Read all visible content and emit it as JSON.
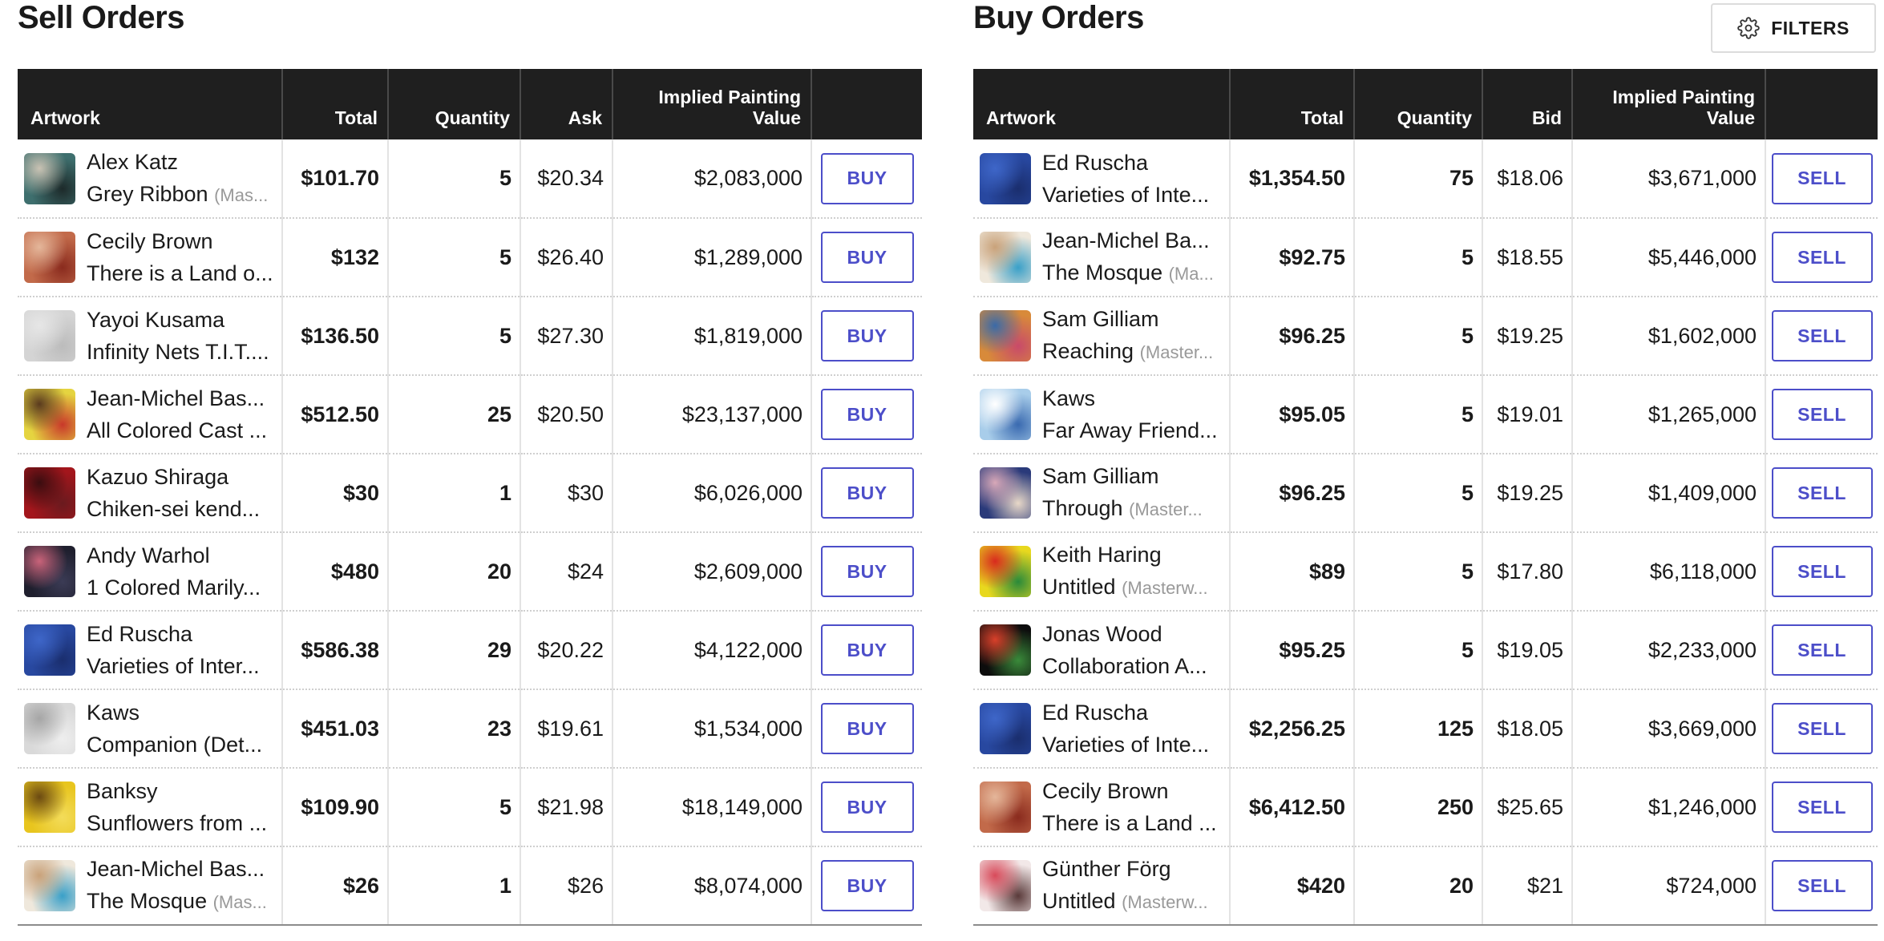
{
  "filters_label": "FILTERS",
  "accent_color": "#4c4ec9",
  "sell": {
    "title": "Sell Orders",
    "columns": {
      "artwork": "Artwork",
      "total": "Total",
      "quantity": "Quantity",
      "price": "Ask",
      "implied": "Implied Painting Value"
    },
    "action_label": "BUY",
    "rows": [
      {
        "artist": "Alex Katz",
        "title": "Grey Ribbon",
        "edition": "(Mas...",
        "total": "$101.70",
        "quantity": "5",
        "price": "$20.34",
        "implied": "$2,083,000",
        "thumb_colors": [
          "#3e6f6e",
          "#c9c2b3",
          "#1d2a2a"
        ]
      },
      {
        "artist": "Cecily Brown",
        "title": "There is a Land o...",
        "edition": "",
        "total": "$132",
        "quantity": "5",
        "price": "$26.40",
        "implied": "$1,289,000",
        "thumb_colors": [
          "#c26a4a",
          "#e4b69a",
          "#8a2b1e"
        ]
      },
      {
        "artist": "Yayoi Kusama",
        "title": "Infinity Nets T.I.T....",
        "edition": "",
        "total": "$136.50",
        "quantity": "5",
        "price": "$27.30",
        "implied": "$1,819,000",
        "thumb_colors": [
          "#d4d4d4",
          "#e6e6e6",
          "#bcbcbc"
        ]
      },
      {
        "artist": "Jean-Michel Bas...",
        "title": "All Colored Cast ...",
        "edition": "",
        "total": "$512.50",
        "quantity": "25",
        "price": "$20.50",
        "implied": "$23,137,000",
        "thumb_colors": [
          "#e5d440",
          "#5a3a1e",
          "#c8382a"
        ]
      },
      {
        "artist": "Kazuo Shiraga",
        "title": "Chiken-sei kend...",
        "edition": "",
        "total": "$30",
        "quantity": "1",
        "price": "$30",
        "implied": "$6,026,000",
        "thumb_colors": [
          "#a3161c",
          "#3a0d10",
          "#6a1a1e"
        ]
      },
      {
        "artist": "Andy Warhol",
        "title": "1 Colored Marily...",
        "edition": "",
        "total": "$480",
        "quantity": "20",
        "price": "$24",
        "implied": "$2,609,000",
        "thumb_colors": [
          "#1f1f2e",
          "#c9637a",
          "#3b3b55"
        ]
      },
      {
        "artist": "Ed Ruscha",
        "title": "Varieties of Inter...",
        "edition": "",
        "total": "$586.38",
        "quantity": "29",
        "price": "$20.22",
        "implied": "$4,122,000",
        "thumb_colors": [
          "#2848a0",
          "#3e66c8",
          "#1a2e6e"
        ]
      },
      {
        "artist": "Kaws",
        "title": "Companion (Det...",
        "edition": "",
        "total": "$451.03",
        "quantity": "23",
        "price": "$19.61",
        "implied": "$1,534,000",
        "thumb_colors": [
          "#d9d9d9",
          "#a6a6a6",
          "#eeeeee"
        ]
      },
      {
        "artist": "Banksy",
        "title": "Sunflowers from ...",
        "edition": "",
        "total": "$109.90",
        "quantity": "5",
        "price": "$21.98",
        "implied": "$18,149,000",
        "thumb_colors": [
          "#e8c51e",
          "#6b4a12",
          "#f3dc5a"
        ]
      },
      {
        "artist": "Jean-Michel Bas...",
        "title": "The Mosque",
        "edition": "(Mas...",
        "total": "$26",
        "quantity": "1",
        "price": "$26",
        "implied": "$8,074,000",
        "thumb_colors": [
          "#efe8dc",
          "#c9a27a",
          "#3aa0c8"
        ]
      }
    ]
  },
  "buy": {
    "title": "Buy Orders",
    "columns": {
      "artwork": "Artwork",
      "total": "Total",
      "quantity": "Quantity",
      "price": "Bid",
      "implied": "Implied Painting Value"
    },
    "action_label": "SELL",
    "rows": [
      {
        "artist": "Ed Ruscha",
        "title": "Varieties of Inte...",
        "edition": "",
        "total": "$1,354.50",
        "quantity": "75",
        "price": "$18.06",
        "implied": "$3,671,000",
        "thumb_colors": [
          "#2848a0",
          "#3e66c8",
          "#1a2e6e"
        ]
      },
      {
        "artist": "Jean-Michel Ba...",
        "title": "The Mosque",
        "edition": "(Ma...",
        "total": "$92.75",
        "quantity": "5",
        "price": "$18.55",
        "implied": "$5,446,000",
        "thumb_colors": [
          "#efe8dc",
          "#c9a27a",
          "#3aa0c8"
        ]
      },
      {
        "artist": "Sam Gilliam",
        "title": "Reaching",
        "edition": "(Master...",
        "total": "$96.25",
        "quantity": "5",
        "price": "$19.25",
        "implied": "$1,602,000",
        "thumb_colors": [
          "#d88a3a",
          "#3a6aa8",
          "#c84a6a"
        ]
      },
      {
        "artist": "Kaws",
        "title": "Far Away Friend...",
        "edition": "",
        "total": "$95.05",
        "quantity": "5",
        "price": "$19.01",
        "implied": "$1,265,000",
        "thumb_colors": [
          "#a8cdea",
          "#ffffff",
          "#3a6ab0"
        ]
      },
      {
        "artist": "Sam Gilliam",
        "title": "Through",
        "edition": "(Master...",
        "total": "$96.25",
        "quantity": "5",
        "price": "$19.25",
        "implied": "$1,409,000",
        "thumb_colors": [
          "#2a3a7a",
          "#d8a8b8",
          "#e8d8c8"
        ]
      },
      {
        "artist": "Keith Haring",
        "title": "Untitled",
        "edition": "(Masterw...",
        "total": "$89",
        "quantity": "5",
        "price": "$17.80",
        "implied": "$6,118,000",
        "thumb_colors": [
          "#e8d81e",
          "#d82a1e",
          "#2a8a3a"
        ]
      },
      {
        "artist": "Jonas Wood",
        "title": "Collaboration A...",
        "edition": "",
        "total": "$95.25",
        "quantity": "5",
        "price": "$19.05",
        "implied": "$2,233,000",
        "thumb_colors": [
          "#0d0d0d",
          "#d8402a",
          "#3a8a3a"
        ]
      },
      {
        "artist": "Ed Ruscha",
        "title": "Varieties of Inte...",
        "edition": "",
        "total": "$2,256.25",
        "quantity": "125",
        "price": "$18.05",
        "implied": "$3,669,000",
        "thumb_colors": [
          "#2848a0",
          "#3e66c8",
          "#1a2e6e"
        ]
      },
      {
        "artist": "Cecily Brown",
        "title": "There is a Land ...",
        "edition": "",
        "total": "$6,412.50",
        "quantity": "250",
        "price": "$25.65",
        "implied": "$1,246,000",
        "thumb_colors": [
          "#c26a4a",
          "#e4b69a",
          "#8a2b1e"
        ]
      },
      {
        "artist": "Günther Förg",
        "title": "Untitled",
        "edition": "(Masterw...",
        "total": "$420",
        "quantity": "20",
        "price": "$21",
        "implied": "$724,000",
        "thumb_colors": [
          "#f2e8e8",
          "#d84a5a",
          "#5a3a3a"
        ]
      }
    ]
  }
}
